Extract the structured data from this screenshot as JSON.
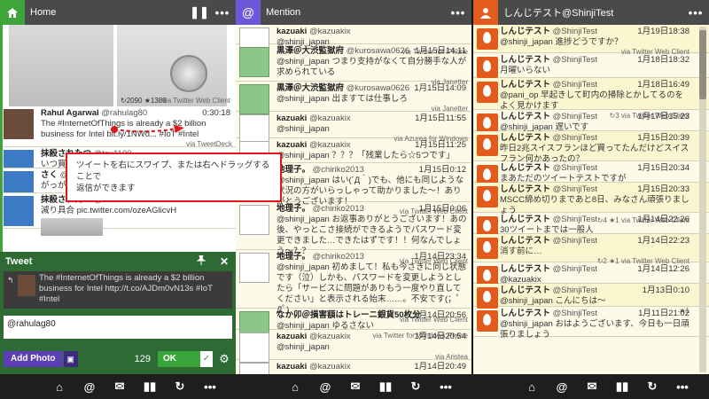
{
  "col1": {
    "title": "Home",
    "pause_icon": "❚❚",
    "more": "•••",
    "image_tweet": {
      "stats": "↻2090 ★1388",
      "via": "via Twitter Web Client"
    },
    "tweets": [
      {
        "name": "Rahul Agarwal",
        "screen": "@rahulag80",
        "time": "0:30:18",
        "body": "The #InternetOfThings is already a $2 billion business for Intel bit.ly/1NWd... #IoT #Intel",
        "via": "via TweetDeck"
      },
      {
        "name": "抹殺されたつ",
        "screen": "@tsu1100",
        "time": "0:30:?",
        "body": "いつ買った",
        "via": ""
      },
      {
        "name": "さく",
        "screen": "@s...",
        "time": "",
        "body": "がっがらー",
        "via": ""
      },
      {
        "name": "抹殺されたつ",
        "screen": "@tsu1100",
        "time": "0:29:55",
        "body": "減り具合 pic.twitter.com/ozeAGlicvH",
        "via": ""
      }
    ]
  },
  "tooltip": {
    "line1": "ツイートを右にスワイプ、または右へドラッグすることで",
    "line2": "返信ができます"
  },
  "compose": {
    "title": "Tweet",
    "pin_icon": "📌",
    "close_icon": "✕",
    "quote": "The #InternetOfThings is already a $2 billion business for Intel http://t.co/AJDm0vN13s #IoT #Intel",
    "text": "@rahulag80",
    "add_photo": "Add Photo",
    "count": "129",
    "ok": "OK",
    "ok_check": "✓",
    "gear": "⚙"
  },
  "col2": {
    "title": "Mention",
    "more": "•••",
    "tweets": [
      {
        "name": "kazuaki",
        "screen": "@kazuakix",
        "time": "",
        "body": "@shinji_japan",
        "via": "via Twitter for iPhone",
        "av": "w"
      },
      {
        "name": "黒澤＠大渋監獄府",
        "screen": "@kurosawa0626",
        "time": "1月15日14:11",
        "body": "@shinji_japan つまり支持がなくて自分勝手な人が求められている",
        "via": "via Janetter",
        "av": "g"
      },
      {
        "name": "黒澤＠大渋監獄府",
        "screen": "@kurosawa0626",
        "time": "1月15日14:09",
        "body": "@shinji_japan 出ますては仕事しろ",
        "via": "via Janetter",
        "av": "g"
      },
      {
        "name": "kazuaki",
        "screen": "@kazuakix",
        "time": "1月15日11:55",
        "body": "@shinji_japan",
        "via": "via Azurea for Windows",
        "av": "w"
      },
      {
        "name": "kazuaki",
        "screen": "@kazuakix",
        "time": "1月15日11:25",
        "body": "@shinji_japan ？？？「残業したら☆5つです」",
        "via": "",
        "av": "w"
      },
      {
        "name": "地理子。",
        "screen": "@chiriko2013",
        "time": "1月15日0:12",
        "body": "@shinji_japan はい(´Д｀)でも、他にも同じような状況の方がいらっしゃって助かりました〜！ありがとうございます！",
        "via": "via Twitter Web Client",
        "av": "w"
      },
      {
        "name": "地理子。",
        "screen": "@chiriko2013",
        "time": "1月15日0:06",
        "body": "@shinji_japan お返事ありがとうございます！あの後、やっとこさ接続ができるようでパスワード変更できました…できたはずです！！何なんでしょう〜？？",
        "via": "via Twitter Web Client",
        "av": "w"
      },
      {
        "name": "地理子。",
        "screen": "@chiriko2013",
        "time": "1月14日23:34",
        "body": "@shinji_japan 初めまして！私も今さきに同じ状態です（泣）しかも、パスワードを変更しようとしたら「サービスに問題がありもう一度やり直してください」と表示される始末……。不安です(；ﾟДﾟ)",
        "via": "via Twitter Web Client",
        "av": "w"
      },
      {
        "name": "なか卯＠損害額はトレーニ銀貨50枚分",
        "screen": "",
        "time": "1月14日20:56",
        "body": "@shinji_japan ゆるさない",
        "via": "via Twitter for Windows Phone",
        "av": "g"
      },
      {
        "name": "kazuaki",
        "screen": "@kazuakix",
        "time": "1月14日20:54",
        "body": "@shinji_japan",
        "via": "via Aristea",
        "av": "w"
      },
      {
        "name": "kazuaki",
        "screen": "@kazuakix",
        "time": "1月14日20:49",
        "body": "",
        "via": "",
        "av": "w"
      }
    ]
  },
  "col3": {
    "title": "しんじテスト@ShinjiTest",
    "more": "•••",
    "tweets": [
      {
        "name": "しんじテスト",
        "screen": "@ShinjiTest",
        "time": "1月19日18:38",
        "body": "@shinji_japan 進捗どうですか？",
        "via": "via Twitter Web Client"
      },
      {
        "name": "しんじテスト",
        "screen": "@ShinjiTest",
        "time": "1月18日18:32",
        "body": "月曜いらない",
        "via": ""
      },
      {
        "name": "しんじテスト",
        "screen": "@ShinjiTest",
        "time": "1月18日16:49",
        "body": "@pani_op 早起きして町内の掃除とかしてるのをよく見かけます",
        "via": "↻3 via Twitter Web Client"
      },
      {
        "name": "しんじテスト",
        "screen": "@ShinjiTest",
        "time": "1月17日15:23",
        "body": "@shinji_japan 遅いです",
        "via": ""
      },
      {
        "name": "しんじテスト",
        "screen": "@ShinjiTest",
        "time": "1月15日20:39",
        "body": "昨日2兆スイスフランほど買ってたんだけどスイスフラン何かあったの？",
        "via": ""
      },
      {
        "name": "しんじテスト",
        "screen": "@ShinjiTest",
        "time": "1月15日20:34",
        "body": "まあただのツイートテストですが",
        "via": ""
      },
      {
        "name": "しんじテスト",
        "screen": "@ShinjiTest",
        "time": "1月15日20:33",
        "body": "MSCC締め切りまであと8日、みなさん頑張りましょう",
        "via": "↻4 ★1 via Twitter Web Client"
      },
      {
        "name": "しんじテスト",
        "screen": "@ShinjiTest",
        "time": "1月14日22:26",
        "body": "30ツイートまでは一般人",
        "via": "★1"
      },
      {
        "name": "しんじテスト",
        "screen": "@ShinjiTest",
        "time": "1月14日22:23",
        "body": "消す前に…",
        "via": "↻2 ★1 via Twitter Web Client"
      },
      {
        "name": "しんじテスト",
        "screen": "@ShinjiTest",
        "time": "1月14日12:26",
        "body": "@kazuakix",
        "via": "via Tween"
      },
      {
        "name": "しんじテスト",
        "screen": "@ShinjiTest",
        "time": "1月13日0:10",
        "body": "@shinji_japan こんにちは〜",
        "via": "★1"
      },
      {
        "name": "しんじテスト",
        "screen": "@ShinjiTest",
        "time": "1月11日21:02",
        "body": "@shinji_japan おはようございます、今日も一日頑張りましょう",
        "via": ""
      }
    ]
  },
  "bottombar": {
    "icons": [
      "home-icon",
      "at-icon",
      "dm-icon",
      "list-icon",
      "refresh-icon",
      "more-icon"
    ],
    "glyphs": [
      "⌂",
      "@",
      "✉",
      "▮▮",
      "↻",
      "•••"
    ]
  }
}
